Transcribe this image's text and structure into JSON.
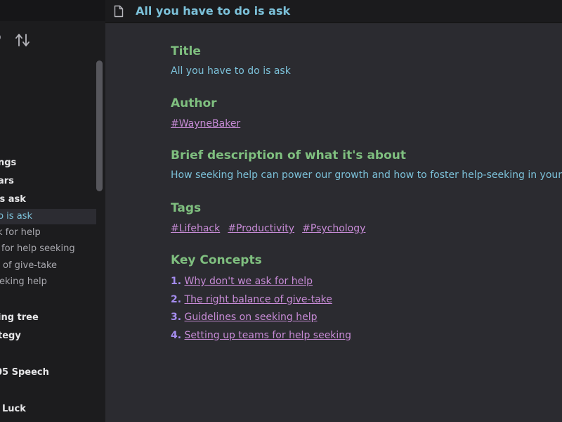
{
  "header": {
    "title": "All you have to do is ask",
    "icon": "file-icon"
  },
  "sidebar": {
    "items": [
      {
        "label": "ngs",
        "style": "bold",
        "active": false
      },
      {
        "label": "ars",
        "style": "bold",
        "active": false
      },
      {
        "label": "is ask",
        "style": "bold",
        "active": false
      },
      {
        "label": "to is ask",
        "style": "sub",
        "active": true
      },
      {
        "label": "k for help",
        "style": "sub",
        "active": false
      },
      {
        "label": "for help seeking",
        "style": "sub",
        "active": false
      },
      {
        "label": "of give-take",
        "style": "sub",
        "active": false
      },
      {
        "label": "eking help",
        "style": "sub",
        "active": false
      },
      {
        "label": "ing tree",
        "style": "bold",
        "active": false
      },
      {
        "label": "tegy",
        "style": "bold",
        "active": false
      },
      {
        "label": "05 Speech",
        "style": "bold",
        "active": false
      },
      {
        "label": "Luck",
        "style": "bold",
        "active": false
      }
    ]
  },
  "content": {
    "title_heading": "Title",
    "title_value": "All you have to do is ask",
    "author_heading": "Author",
    "author_tag": "#WayneBaker",
    "description_heading": "Brief description of what it's about",
    "description_value": "How seeking help can power our growth and how to foster help-seeking in your te",
    "tags_heading": "Tags",
    "tags": [
      "#Lifehack",
      "#Productivity",
      "#Psychology"
    ],
    "concepts_heading": "Key Concepts",
    "concepts": [
      {
        "num": "1.",
        "label": "Why don't we ask for help"
      },
      {
        "num": "2.",
        "label": "The right balance of give-take"
      },
      {
        "num": "3.",
        "label": "Guidelines on seeking help"
      },
      {
        "num": "4.",
        "label": "Setting up teams for help seeking"
      }
    ]
  },
  "colors": {
    "heading": "#7fbf7f",
    "text": "#7cc1d9",
    "link": "#c78bd6",
    "number": "#a58df0"
  }
}
